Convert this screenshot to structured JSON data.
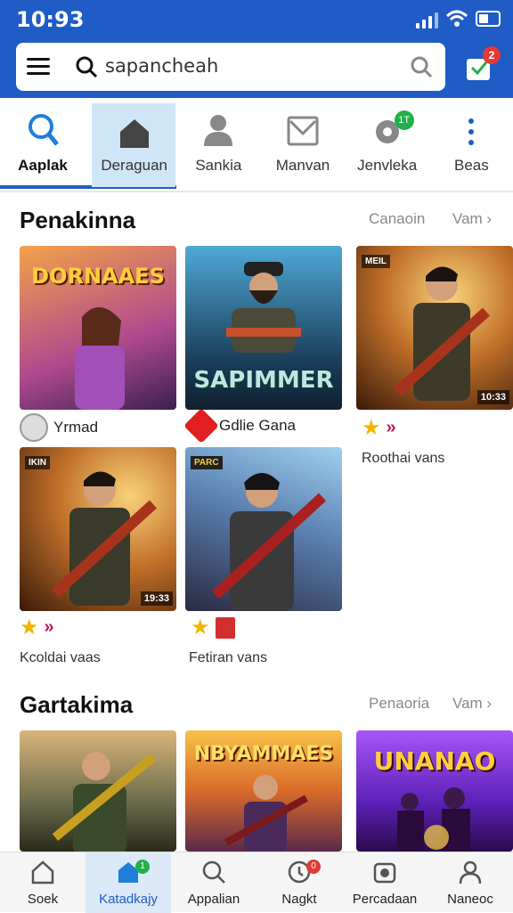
{
  "status": {
    "time": "10:93"
  },
  "search": {
    "placeholder": "sapancheah"
  },
  "cart": {
    "badge": "2"
  },
  "tabs": [
    {
      "label": "Aaplak",
      "icon": "search-icon"
    },
    {
      "label": "Deraguan",
      "icon": "house-icon"
    },
    {
      "label": "Sankia",
      "icon": "person-icon"
    },
    {
      "label": "Manvan",
      "icon": "mail-icon"
    },
    {
      "label": "Jenvleka",
      "icon": "gear-icon",
      "badge": "1T"
    },
    {
      "label": "Beas",
      "icon": "more-icon"
    }
  ],
  "section1": {
    "title": "Penakinna",
    "link1": "Canaoin",
    "link2": "Vam",
    "cards": [
      {
        "caption": "DORNAAES",
        "author": "Yrmad"
      },
      {
        "caption": "SAPIMMER",
        "author": "Gdlie Gana"
      },
      {
        "tag": "MEIL",
        "time": "10:33",
        "sub": "Roothai vans"
      },
      {
        "tag": "IKIN",
        "time": "19:33",
        "sub": "Kcoldai vaas"
      },
      {
        "tag": "PARC",
        "sub": "Fetiran vans"
      }
    ]
  },
  "section2": {
    "title": "Gartakima",
    "link1": "Penaoria",
    "link2": "Vam",
    "cards": [
      {
        "caption": ""
      },
      {
        "caption": "NBYAMMAES"
      },
      {
        "caption": "UNANAO"
      }
    ]
  },
  "bottomnav": [
    {
      "label": "Soek",
      "icon": "home-icon"
    },
    {
      "label": "Katadkajy",
      "icon": "store-icon",
      "badge": "1"
    },
    {
      "label": "Appalian",
      "icon": "search-icon"
    },
    {
      "label": "Nagkt",
      "icon": "notification-icon",
      "badge": "0"
    },
    {
      "label": "Percadaan",
      "icon": "camera-icon"
    },
    {
      "label": "Naneoc",
      "icon": "profile-icon"
    }
  ]
}
